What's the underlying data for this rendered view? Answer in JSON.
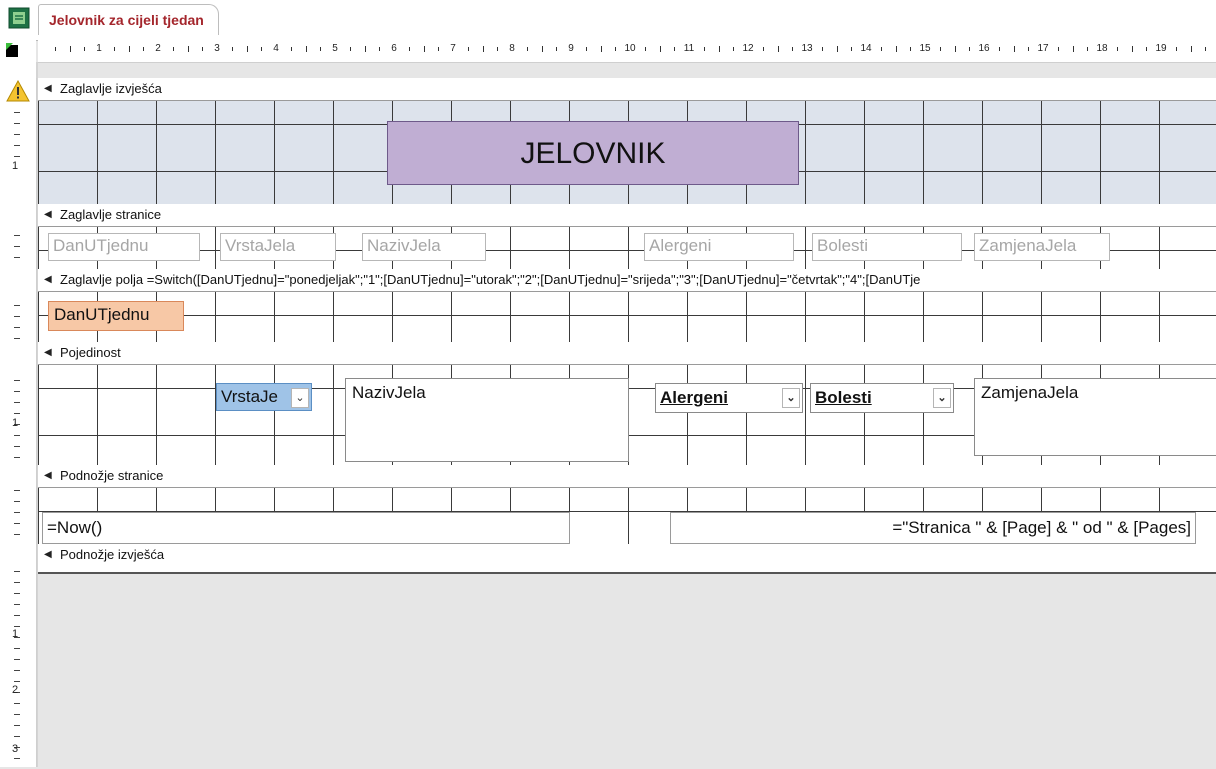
{
  "tab": {
    "title": "Jelovnik za cijeli tjedan"
  },
  "ruler": {
    "numbers": [
      "1",
      "2",
      "3",
      "4",
      "5",
      "6",
      "7",
      "8",
      "9",
      "10",
      "11",
      "12",
      "13",
      "14",
      "15",
      "16",
      "17",
      "18",
      "19",
      "2"
    ]
  },
  "vertical_ruler": {
    "numbers": [
      "1",
      "1",
      "1",
      "2",
      "3"
    ]
  },
  "sections": {
    "report_header": "Zaglavlje izvješća",
    "page_header": "Zaglavlje stranice",
    "group_header": "Zaglavlje polja =Switch([DanUTjednu]=\"ponedjeljak\";\"1\";[DanUTjednu]=\"utorak\";\"2\";[DanUTjednu]=\"srijeda\";\"3\";[DanUTjednu]=\"četvrtak\";\"4\";[DanUTje",
    "detail": "Pojedinost",
    "page_footer": "Podnožje stranice",
    "report_footer": "Podnožje izvješća"
  },
  "report_title": "JELOVNIK",
  "page_header_labels": [
    "DanUTjednu",
    "VrstaJela",
    "NazivJela",
    "Alergeni",
    "Bolesti",
    "ZamjenaJela"
  ],
  "group_field": "DanUTjednu",
  "detail": {
    "vrsta_combo": "VrstaJe",
    "naziv": "NazivJela",
    "alergeni_combo": "Alergeni",
    "bolesti_combo": "Bolesti",
    "zamjena": "ZamjenaJela"
  },
  "footer": {
    "now": "=Now()",
    "pages": "=\"Stranica \" & [Page] & \" od \" & [Pages]"
  },
  "colors": {
    "tab_title": "#a4262c",
    "title_box": "#c0aed3",
    "group_field": "#f7c8a6",
    "vrsta_combo": "#9fc3e7",
    "report_header_band": "#dde3ec"
  },
  "icons": [
    "access-report-icon",
    "warning-icon",
    "combo-dropdown-icon",
    "section-arrow-icon"
  ]
}
